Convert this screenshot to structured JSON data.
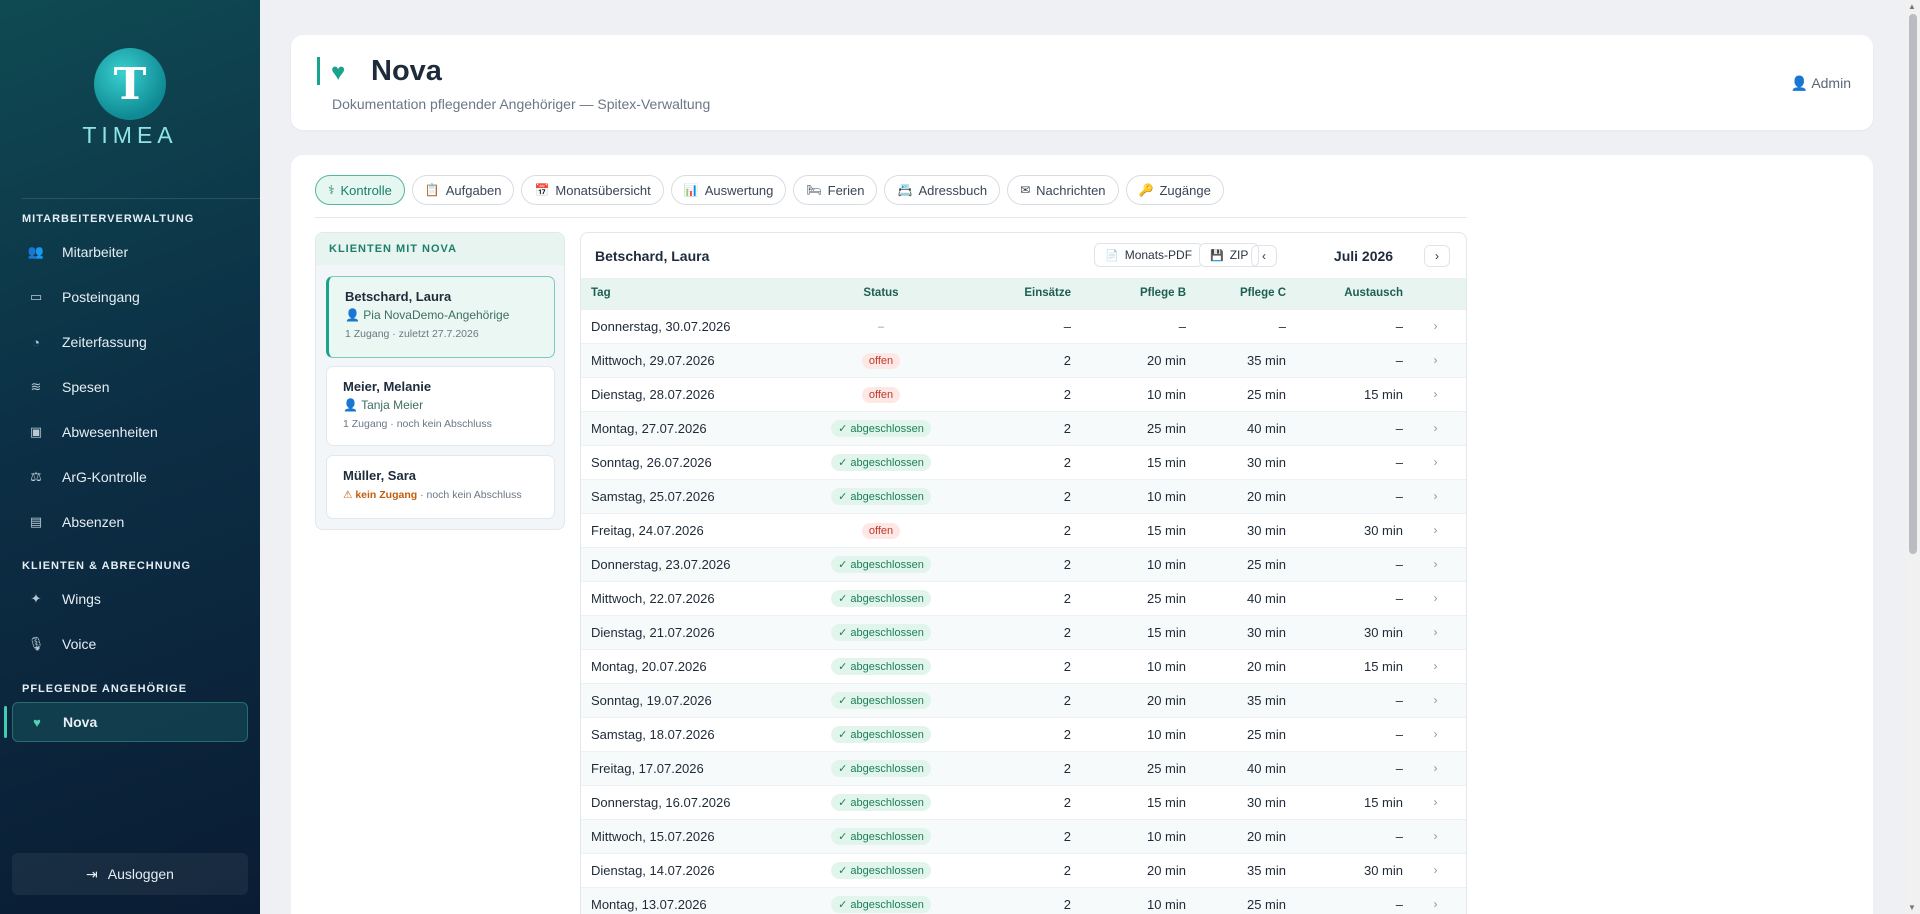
{
  "sidebar": {
    "logo_text": "TIMEA",
    "logo_letter": "T",
    "sections": [
      "MITARBEITERVERWALTUNG",
      "KLIENTEN & ABRECHNUNG",
      "PFLEGENDE ANGEHÖRIGE"
    ],
    "items": [
      {
        "label": "Mitarbeiter",
        "icon": "users-icon"
      },
      {
        "label": "Posteingang",
        "icon": "inbox-icon"
      },
      {
        "label": "Zeiterfassung",
        "icon": "pie-chart-icon"
      },
      {
        "label": "Spesen",
        "icon": "coins-icon"
      },
      {
        "label": "Abwesenheiten",
        "icon": "calendar-check-icon"
      },
      {
        "label": "ArG-Kontrolle",
        "icon": "scale-icon"
      },
      {
        "label": "Absenzen",
        "icon": "clipboard-icon"
      },
      {
        "label": "Wings",
        "icon": "person-walking-icon"
      },
      {
        "label": "Voice",
        "icon": "microphone-icon"
      },
      {
        "label": "Nova",
        "icon": "hand-holding-heart-icon"
      }
    ],
    "logout_label": "Ausloggen"
  },
  "header": {
    "title": "Nova",
    "subtitle": "Dokumentation pflegender Angehöriger — Spitex-Verwaltung",
    "user_label": "Admin"
  },
  "tabs": [
    {
      "label": "Kontrolle",
      "icon": "stethoscope-icon",
      "active": true
    },
    {
      "label": "Aufgaben",
      "icon": "clipboard-list-icon"
    },
    {
      "label": "Monatsübersicht",
      "icon": "calendar-icon"
    },
    {
      "label": "Auswertung",
      "icon": "bar-chart-icon"
    },
    {
      "label": "Ferien",
      "icon": "bed-icon"
    },
    {
      "label": "Adressbuch",
      "icon": "address-book-icon"
    },
    {
      "label": "Nachrichten",
      "icon": "envelope-icon"
    },
    {
      "label": "Zugänge",
      "icon": "key-icon"
    }
  ],
  "clients": {
    "heading": "KLIENTEN MIT NOVA",
    "items": [
      {
        "name": "Betschard, Laura",
        "person": "Pia NovaDemo-Angehörige",
        "meta": "1 Zugang · zuletzt 27.7.2026"
      },
      {
        "name": "Meier, Melanie",
        "person": "Tanja Meier",
        "meta": "1 Zugang · noch kein Abschluss"
      },
      {
        "name": "Müller, Sara",
        "warn": "⚠ kein Zugang",
        "meta": " · noch kein Abschluss"
      }
    ]
  },
  "panel": {
    "client_name": "Betschard, Laura",
    "pdf_label": "Monats-PDF",
    "zip_label": "ZIP",
    "prev": "‹",
    "next": "›",
    "month": "Juli 2026",
    "columns": [
      "Tag",
      "Status",
      "Einsätze",
      "Pflege B",
      "Pflege C",
      "Austausch"
    ],
    "rows": [
      [
        "Donnerstag, 30.07.2026",
        "–",
        "–",
        "–",
        "–",
        "–"
      ],
      [
        "Mittwoch, 29.07.2026",
        "offen",
        "2",
        "20 min",
        "35 min",
        "–"
      ],
      [
        "Dienstag, 28.07.2026",
        "offen",
        "2",
        "10 min",
        "25 min",
        "15 min"
      ],
      [
        "Montag, 27.07.2026",
        "✓ abgeschlossen",
        "2",
        "25 min",
        "40 min",
        "–"
      ],
      [
        "Sonntag, 26.07.2026",
        "✓ abgeschlossen",
        "2",
        "15 min",
        "30 min",
        "–"
      ],
      [
        "Samstag, 25.07.2026",
        "✓ abgeschlossen",
        "2",
        "10 min",
        "20 min",
        "–"
      ],
      [
        "Freitag, 24.07.2026",
        "offen",
        "2",
        "15 min",
        "30 min",
        "30 min"
      ],
      [
        "Donnerstag, 23.07.2026",
        "✓ abgeschlossen",
        "2",
        "10 min",
        "25 min",
        "–"
      ],
      [
        "Mittwoch, 22.07.2026",
        "✓ abgeschlossen",
        "2",
        "25 min",
        "40 min",
        "–"
      ],
      [
        "Dienstag, 21.07.2026",
        "✓ abgeschlossen",
        "2",
        "15 min",
        "30 min",
        "30 min"
      ],
      [
        "Montag, 20.07.2026",
        "✓ abgeschlossen",
        "2",
        "10 min",
        "20 min",
        "15 min"
      ],
      [
        "Sonntag, 19.07.2026",
        "✓ abgeschlossen",
        "2",
        "20 min",
        "35 min",
        "–"
      ],
      [
        "Samstag, 18.07.2026",
        "✓ abgeschlossen",
        "2",
        "10 min",
        "25 min",
        "–"
      ],
      [
        "Freitag, 17.07.2026",
        "✓ abgeschlossen",
        "2",
        "25 min",
        "40 min",
        "–"
      ],
      [
        "Donnerstag, 16.07.2026",
        "✓ abgeschlossen",
        "2",
        "15 min",
        "30 min",
        "15 min"
      ],
      [
        "Mittwoch, 15.07.2026",
        "✓ abgeschlossen",
        "2",
        "10 min",
        "20 min",
        "–"
      ],
      [
        "Dienstag, 14.07.2026",
        "✓ abgeschlossen",
        "2",
        "20 min",
        "35 min",
        "30 min"
      ],
      [
        "Montag, 13.07.2026",
        "✓ abgeschlossen",
        "2",
        "10 min",
        "25 min",
        "–"
      ]
    ]
  },
  "colors": {
    "accent": "#1aa38c",
    "offen": "#c0392b",
    "abgeschlossen": "#1d7f5a"
  }
}
